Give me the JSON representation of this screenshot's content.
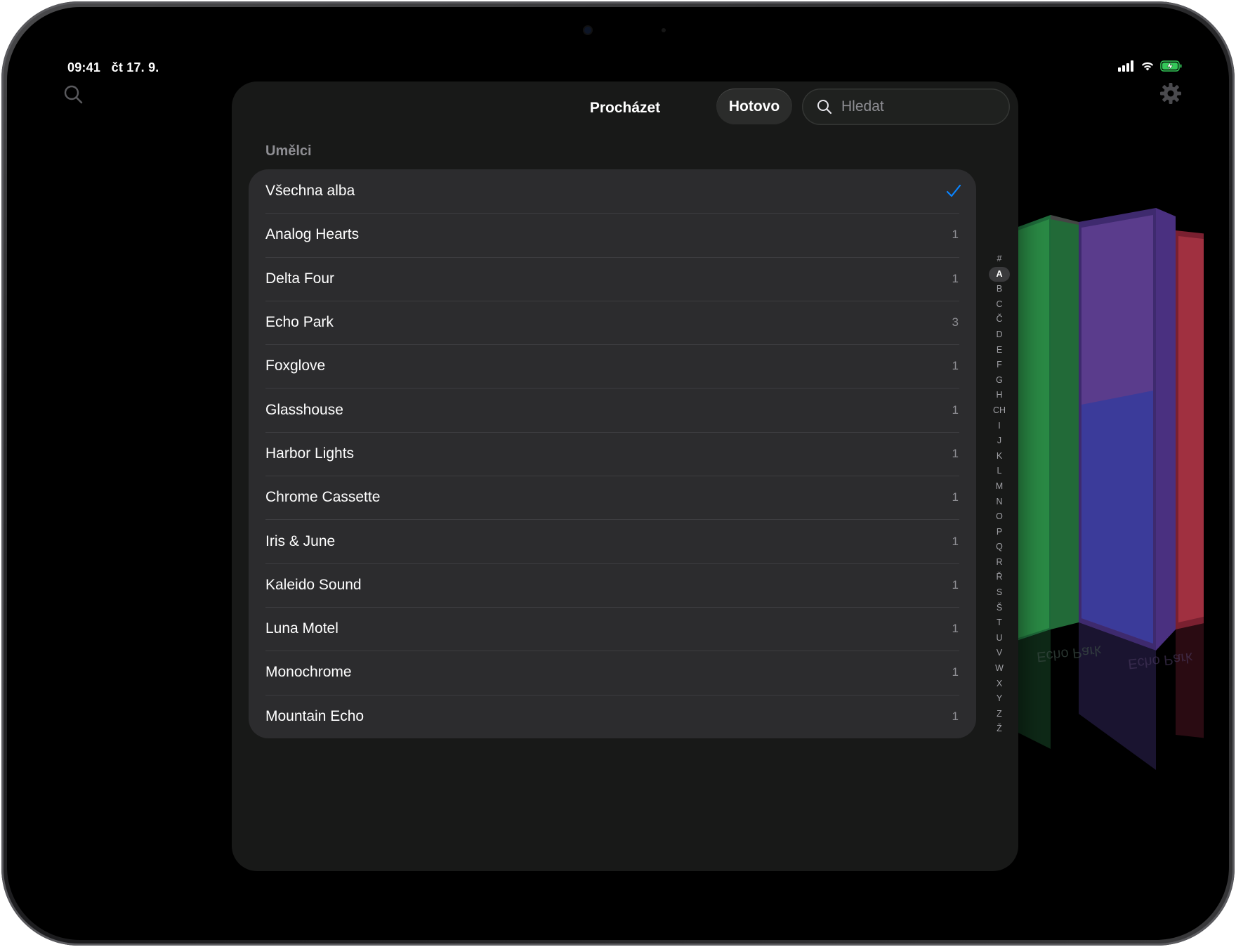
{
  "status_bar": {
    "time": "09:41",
    "date": "čt 17. 9."
  },
  "modal": {
    "title": "Procházet",
    "done_label": "Hotovo",
    "search_placeholder": "Hledat",
    "section_header": "Umělci",
    "rows": [
      {
        "label": "Všechna alba",
        "selected": true
      },
      {
        "label": "Analog Hearts",
        "count": "1"
      },
      {
        "label": "Delta Four",
        "count": "1"
      },
      {
        "label": "Echo Park",
        "count": "3"
      },
      {
        "label": "Foxglove",
        "count": "1"
      },
      {
        "label": "Glasshouse",
        "count": "1"
      },
      {
        "label": "Harbor Lights",
        "count": "1"
      },
      {
        "label": "Chrome Cassette",
        "count": "1"
      },
      {
        "label": "Iris & June",
        "count": "1"
      },
      {
        "label": "Kaleido Sound",
        "count": "1"
      },
      {
        "label": "Luna Motel",
        "count": "1"
      },
      {
        "label": "Monochrome",
        "count": "1"
      },
      {
        "label": "Mountain Echo",
        "count": "1"
      }
    ]
  },
  "index_letters": [
    "#",
    "A",
    "B",
    "C",
    "Č",
    "D",
    "E",
    "F",
    "G",
    "H",
    "CH",
    "I",
    "J",
    "K",
    "L",
    "M",
    "N",
    "O",
    "P",
    "Q",
    "R",
    "Ř",
    "S",
    "Š",
    "T",
    "U",
    "V",
    "W",
    "X",
    "Y",
    "Z",
    "Ž"
  ],
  "index_active": "A",
  "background": {
    "album_reflection_text": "Echo Park"
  },
  "colors": {
    "accent": "#0a84ff",
    "modal_bg": "#181918",
    "list_bg": "#2c2c2e",
    "secondary_text": "#8e8e93",
    "battery": "#34c759"
  }
}
